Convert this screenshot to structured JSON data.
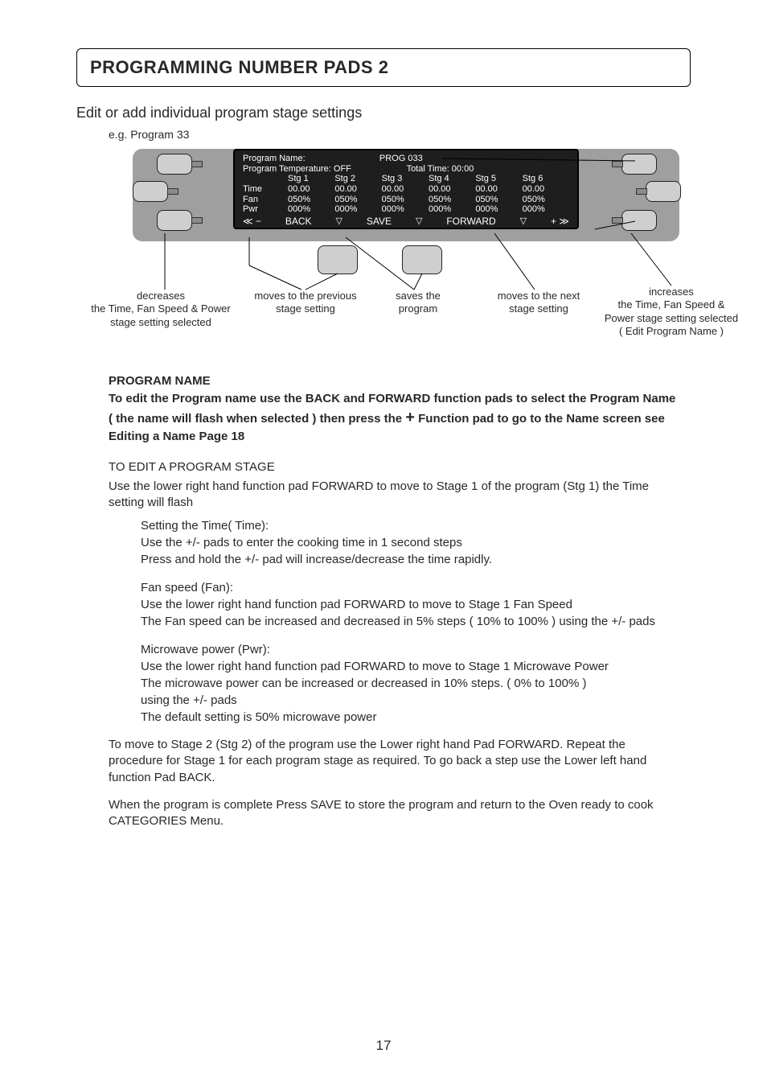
{
  "page": {
    "title": "PROGRAMMING NUMBER PADS 2",
    "subhead": "Edit or add  individual program stage settings",
    "example_label": "e.g. Program 33",
    "number": "17"
  },
  "display": {
    "program_name_label": "Program Name:",
    "program_name_value": "PROG 033",
    "program_temp_label": "Program Temperature: OFF",
    "total_time_label": "Total Time: 00:00",
    "stage_headers": [
      "Stg 1",
      "Stg 2",
      "Stg 3",
      "Stg 4",
      "Stg 5",
      "Stg 6"
    ],
    "rows": {
      "time_label": "Time",
      "time_values": [
        "00.00",
        "00.00",
        "00.00",
        "00.00",
        "00.00",
        "00.00"
      ],
      "fan_label": "Fan",
      "fan_values": [
        "050%",
        "050%",
        "050%",
        "050%",
        "050%",
        "050%"
      ],
      "pwr_label": "Pwr",
      "pwr_values": [
        "000%",
        "000%",
        "000%",
        "000%",
        "000%",
        "000%"
      ]
    },
    "footer": {
      "left_icon": "≪ −",
      "back": "BACK",
      "save": "SAVE",
      "forward": "FORWARD",
      "right_icon": "+ ≫"
    }
  },
  "annotations": {
    "a1_l1": "decreases",
    "a1_l2": "the Time,  Fan Speed & Power",
    "a1_l3": "stage setting selected",
    "a2_l1": "moves to the previous",
    "a2_l2": "stage setting",
    "a3_l1": "saves the",
    "a3_l2": "program",
    "a4_l1": "moves to the next",
    "a4_l2": "stage setting",
    "a5_l1": "increases",
    "a5_l2": "the Time,  Fan Speed &",
    "a5_l3": "Power stage setting selected",
    "a5_l4": "( Edit Program Name )"
  },
  "body": {
    "pn_head": "PROGRAM NAME",
    "pn_l1": "To edit the Program name use the BACK and FORWARD function pads to select the Program Name",
    "pn_l2a": "( the name will flash when selected ) then press the ",
    "pn_plus": "+",
    "pn_l2b": " Function pad to go to the Name screen see",
    "pn_l3": "Editing a Name Page 18",
    "edit_head": "TO EDIT A PROGRAM STAGE",
    "edit_p": "Use the lower right hand function pad FORWARD to move to Stage 1 of the program (Stg 1)  the Time setting will flash",
    "time_head": "Setting the Time( Time):",
    "time_l1": "Use the +/- pads to enter the cooking time in 1 second steps",
    "time_l2": "Press and hold the +/- pad will increase/decrease the time rapidly.",
    "fan_head": "Fan speed (Fan):",
    "fan_l1": "Use the lower right hand function pad FORWARD to move to Stage 1 Fan Speed",
    "fan_l2": "The Fan speed can be increased and decreased in 5% steps ( 10% to 100% ) using the +/- pads",
    "pwr_head": "Microwave power (Pwr):",
    "pwr_l1": "Use the lower right hand function pad FORWARD to move to Stage 1 Microwave Power",
    "pwr_l2": "The microwave power can be increased or decreased in 10% steps. ( 0% to 100% )",
    "pwr_l3": "using the +/- pads",
    "pwr_l4": "The default setting is 50% microwave power",
    "tail1": "To move to Stage 2 (Stg 2) of the program use the Lower right hand Pad FORWARD. Repeat the procedure for Stage 1 for each program stage as required. To go back a step use the Lower left hand function Pad BACK.",
    "tail2": "When the program is complete Press SAVE to store the program and return to the Oven ready to cook CATEGORIES Menu."
  }
}
